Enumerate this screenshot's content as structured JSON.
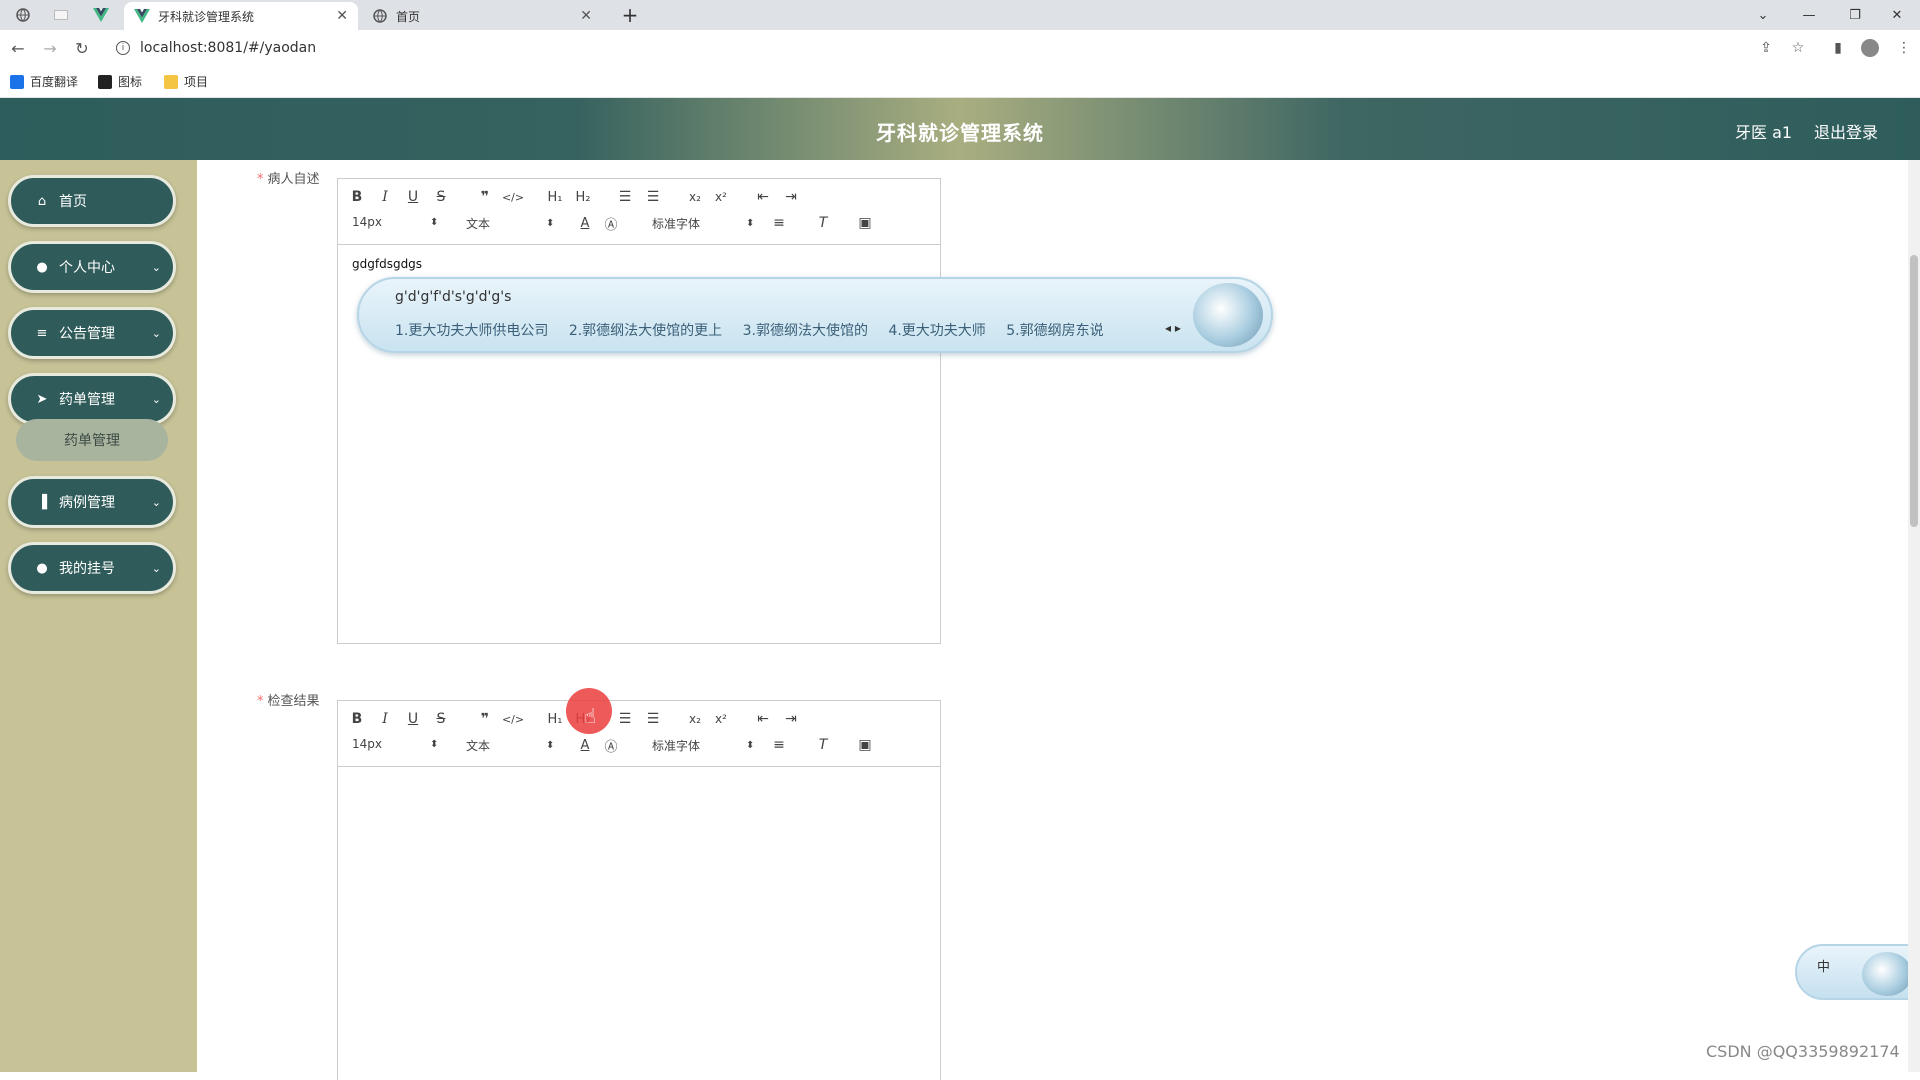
{
  "browser": {
    "tabs": [
      {
        "title": "牙科就诊管理系统",
        "active": true
      },
      {
        "title": "首页",
        "active": false
      }
    ],
    "new_tab": "+",
    "url": "localhost:8081/#/yaodan",
    "bookmarks": [
      {
        "label": "百度翻译",
        "icon": "translate-icon",
        "color": "#1a73e8"
      },
      {
        "label": "图标",
        "icon": "image-icon",
        "color": "#222222"
      },
      {
        "label": "项目",
        "icon": "folder-icon",
        "color": "#f4c542"
      }
    ]
  },
  "header": {
    "title": "牙科就诊管理系统",
    "user": "牙医 a1",
    "logout": "退出登录"
  },
  "sidebar": {
    "items": [
      {
        "label": "首页",
        "icon": "home-icon",
        "has_children": false
      },
      {
        "label": "个人中心",
        "icon": "user-icon",
        "has_children": true
      },
      {
        "label": "公告管理",
        "icon": "list-icon",
        "has_children": true
      },
      {
        "label": "药单管理",
        "icon": "send-icon",
        "has_children": true
      },
      {
        "label": "病例管理",
        "icon": "bar-chart-icon",
        "has_children": true
      },
      {
        "label": "我的挂号",
        "icon": "location-icon",
        "has_children": true
      }
    ],
    "sub_item": "药单管理"
  },
  "form": {
    "field1": {
      "label": "病人自述",
      "content": "gdgfdsgdgs"
    },
    "field2": {
      "label": "检查结果",
      "content": ""
    },
    "toolbar": {
      "size": "14px",
      "format": "文本",
      "font": "标准字体",
      "h1": "H₁",
      "h2": "H₂",
      "sub": "x₂",
      "sup": "x²"
    }
  },
  "ime": {
    "composition": "g'd'g'f'd's'g'd'g's",
    "candidates": [
      "1.更大功夫大师供电公司",
      "2.郭德纲法大使馆的更上",
      "3.郭德纲法大使馆的",
      "4.更大功夫大师",
      "5.郭德纲房东说"
    ],
    "tray_label": "中"
  },
  "watermark": "CSDN @QQ3359892174",
  "colors": {
    "header_dark": "#2d5d5c",
    "sidebar_bg": "#c7c397",
    "menu_bg": "#2f5c5a",
    "required": "#f56c6c"
  }
}
